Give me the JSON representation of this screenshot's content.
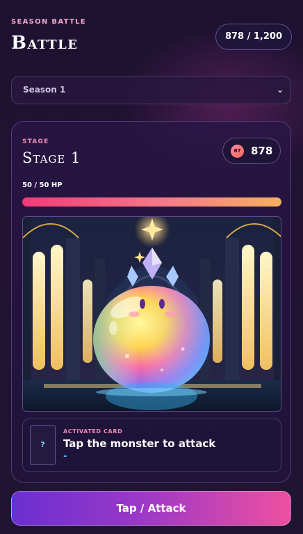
{
  "header": {
    "eyebrow": "SEASON BATTLE",
    "title": "Battle",
    "score": "878 / 1,200"
  },
  "season_select": {
    "selected": "Season 1",
    "icon": "chevron-down-icon"
  },
  "stage": {
    "eyebrow": "STAGE",
    "title": "Stage 1",
    "bt_token_label": "BT",
    "bt_value": "878",
    "hp_label": "50 / 50 HP",
    "hp_fraction": 1.0
  },
  "activated_card": {
    "slot_symbol": "?",
    "eyebrow": "ACTIVATED CARD",
    "title": "Tap the monster to attack",
    "subtitle": "-"
  },
  "action": {
    "attack_label": "Tap / Attack"
  },
  "colors": {
    "accent_pink": "#f08ab4",
    "hp_start": "#f13b78",
    "hp_end": "#f7b060",
    "button_start": "#6a2fd0",
    "button_end": "#ee4fa0"
  }
}
